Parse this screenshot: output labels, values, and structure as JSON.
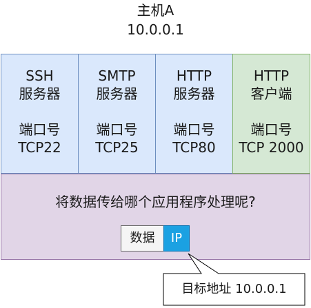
{
  "host": {
    "name": "主机A",
    "ip": "10.0.0.1"
  },
  "apps": [
    {
      "line1": "SSH",
      "line2": "服务器",
      "line3": "端口号",
      "line4": "TCP22"
    },
    {
      "line1": "SMTP",
      "line2": "服务器",
      "line3": "端口号",
      "line4": "TCP25"
    },
    {
      "line1": "HTTP",
      "line2": "服务器",
      "line3": "端口号",
      "line4": "TCP80"
    },
    {
      "line1": "HTTP",
      "line2": "客户端",
      "line3": "端口号",
      "line4": "TCP 2000"
    }
  ],
  "question": "将数据传给哪个应用程序处理呢?",
  "packet": {
    "data_label": "数据",
    "ip_label": "IP"
  },
  "callout": "目标地址 10.0.0.1",
  "colors": {
    "server_fill": "#dae8fc",
    "client_fill": "#d5e8d4",
    "question_fill": "#e1d5e7",
    "ip_fill": "#1ba1e2"
  }
}
